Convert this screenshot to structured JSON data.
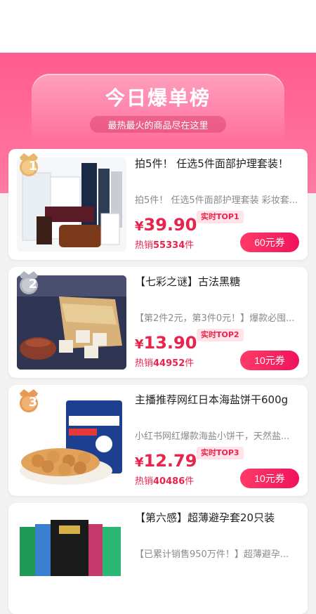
{
  "header": {
    "title": "今日爆单榜",
    "subtitle": "最热最火的商品尽在这里"
  },
  "colors": {
    "accent": "#ff5b8f",
    "price": "#e8244c",
    "coupon": "#f0125c"
  },
  "products": [
    {
      "rank": "1",
      "title": "拍5件！ 任选5件面部护理套装！",
      "desc": "拍5件！ 任选5件面部护理套装 彩妆套...",
      "price_symbol": "¥",
      "price": "39.90",
      "top_label": "实时TOP1",
      "sales_label": "热销",
      "sales": "55334",
      "sales_unit": "件",
      "coupon": "60元券"
    },
    {
      "rank": "2",
      "title": "【七彩之谜】古法黑糖",
      "desc": "【第2件2元，第3件0元！】爆款必囤...",
      "price_symbol": "¥",
      "price": "13.90",
      "top_label": "实时TOP2",
      "sales_label": "热销",
      "sales": "44952",
      "sales_unit": "件",
      "coupon": "10元券"
    },
    {
      "rank": "3",
      "title": "主播推荐网红日本海盐饼干600g",
      "desc": "小红书网红爆款海盐小饼干，天然盐...",
      "price_symbol": "¥",
      "price": "12.79",
      "top_label": "实时TOP3",
      "sales_label": "热销",
      "sales": "40486",
      "sales_unit": "件",
      "coupon": "10元券"
    },
    {
      "title": "【第六感】超薄避孕套20只装",
      "desc": "【已累计销售950万件！】超薄避孕..."
    }
  ]
}
